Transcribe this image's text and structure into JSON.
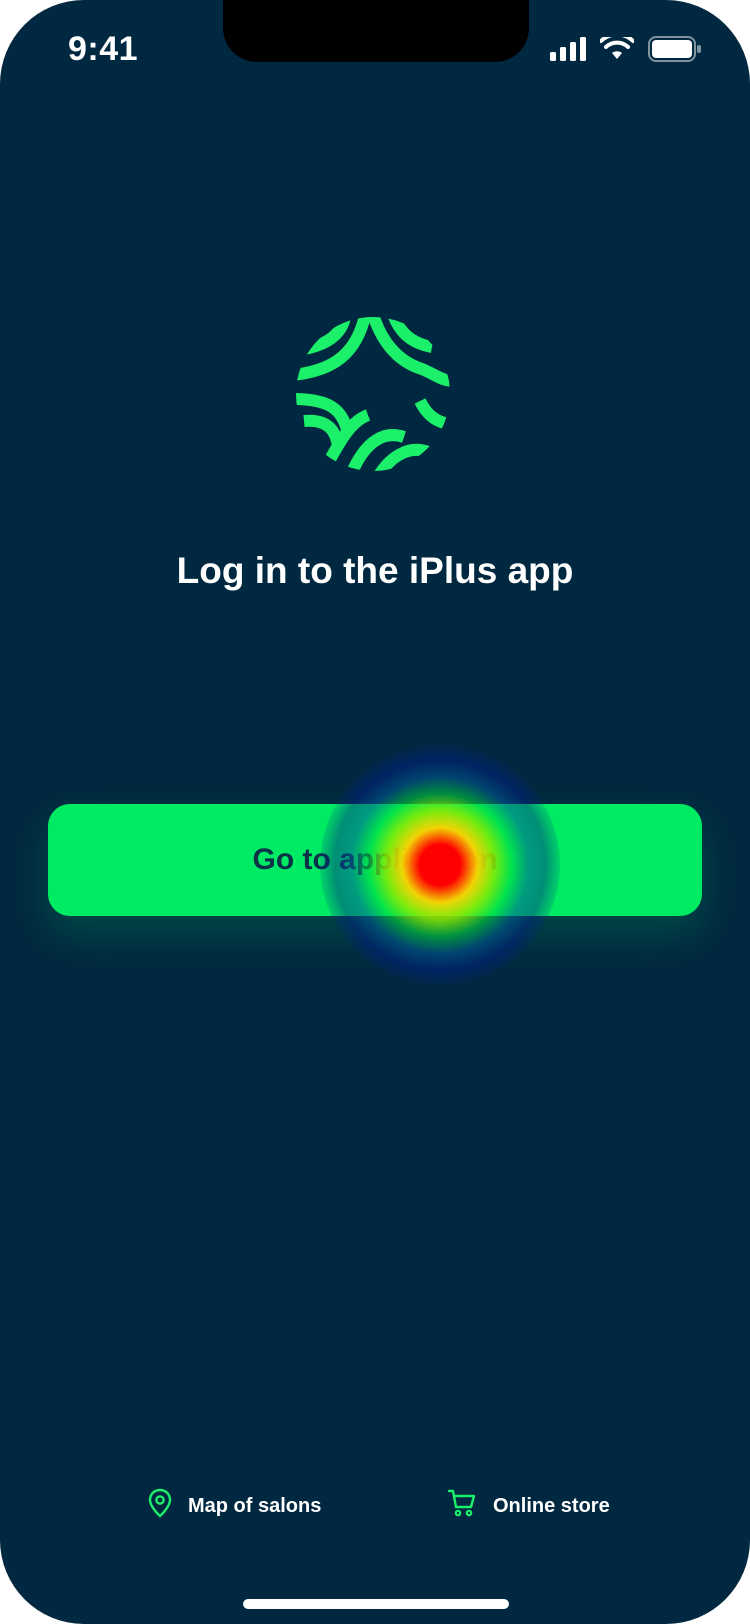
{
  "status_bar": {
    "time": "9:41"
  },
  "brand": {
    "logo_icon": "iplus-logo",
    "accent_color": "#00eb64",
    "background_color": "#002840"
  },
  "main": {
    "headline": "Log in to the iPlus app",
    "cta_label": "Go to application"
  },
  "footer": {
    "links": [
      {
        "label": "Map of salons",
        "icon": "location-pin-icon"
      },
      {
        "label": "Online store",
        "icon": "cart-icon"
      }
    ]
  }
}
